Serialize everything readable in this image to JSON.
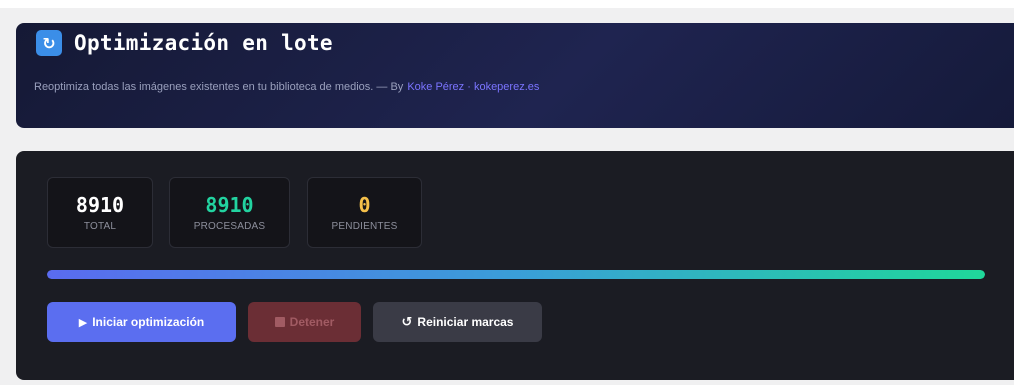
{
  "header": {
    "title": "Optimización en lote",
    "icon": "refresh-icon",
    "subtitle": "Reoptimiza todas las imágenes existentes en tu biblioteca de medios. — By",
    "author_link": "Koke Pérez · kokeperez.es"
  },
  "stats": [
    {
      "value": "8910",
      "label": "TOTAL",
      "color": "#ffffff"
    },
    {
      "value": "8910",
      "label": "PROCESADAS",
      "color": "#22d3a0"
    },
    {
      "value": "0",
      "label": "PENDIENTES",
      "color": "#f5c04a"
    }
  ],
  "progress": {
    "percent": 100
  },
  "buttons": {
    "start_label": "Iniciar optimización",
    "stop_label": "Detener",
    "reset_label": "Reiniciar marcas"
  },
  "colors": {
    "accent": "#5b6ef0",
    "success": "#22d3a0",
    "warning": "#f5c04a",
    "danger_muted": "#6b2e35"
  }
}
